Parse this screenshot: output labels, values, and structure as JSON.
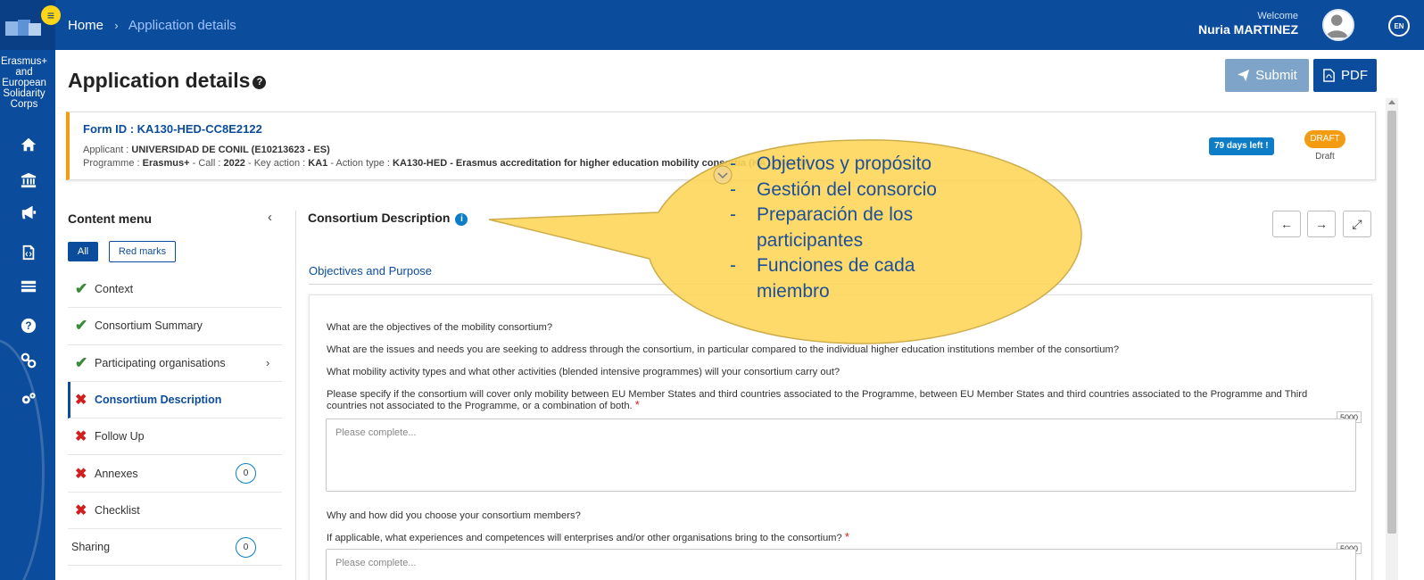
{
  "topbar": {
    "home": "Home",
    "separator": "›",
    "current": "Application details",
    "welcome": "Welcome",
    "user_name": "Nuria MARTINEZ",
    "lang": "EN"
  },
  "sidebar": {
    "program_name": "Erasmus+ and European Solidarity Corps",
    "menu_toggle": "≡",
    "icons": [
      "home-icon",
      "institution-icon",
      "megaphone-icon",
      "document-code-icon",
      "list-icon",
      "help-icon",
      "link-icon",
      "settings-icon"
    ]
  },
  "header": {
    "title": "Application details",
    "help_glyph": "?",
    "submit_label": "Submit",
    "pdf_label": "PDF"
  },
  "form": {
    "id_label": "Form ID : KA130-HED-CC8E2122",
    "applicant_prefix": "Applicant : ",
    "applicant": "UNIVERSIDAD DE CONIL (E10213623 - ES)",
    "programme_prefix": "Programme : ",
    "programme": "Erasmus+",
    "call_prefix": " - Call : ",
    "call": "2022",
    "key_action_prefix": " - Key action : ",
    "key_action": "KA1",
    "action_type_prefix": " - Action type : ",
    "action_type": "KA130-HED - Erasmus accreditation for higher education mobility consortia (KA130-HED)",
    "days_left": "79 days left !",
    "status_badge": "DRAFT",
    "status_label": "Draft"
  },
  "content_menu": {
    "title": "Content menu",
    "collapse": "‹",
    "filter_all": "All",
    "filter_red": "Red marks",
    "items": [
      {
        "label": "Context",
        "status": "ok",
        "status_glyph": "✔",
        "count": "",
        "chevron": ""
      },
      {
        "label": "Consortium Summary",
        "status": "ok",
        "status_glyph": "✔",
        "count": "",
        "chevron": ""
      },
      {
        "label": "Participating organisations",
        "status": "ok",
        "status_glyph": "✔",
        "count": "",
        "chevron": "›"
      },
      {
        "label": "Consortium Description",
        "status": "bad",
        "status_glyph": "✖",
        "count": "",
        "chevron": ""
      },
      {
        "label": "Follow Up",
        "status": "bad",
        "status_glyph": "✖",
        "count": "",
        "chevron": ""
      },
      {
        "label": "Annexes",
        "status": "bad",
        "status_glyph": "✖",
        "count": "0",
        "chevron": ""
      },
      {
        "label": "Checklist",
        "status": "bad",
        "status_glyph": "✖",
        "count": "",
        "chevron": ""
      },
      {
        "label": "Sharing",
        "status": "none",
        "status_glyph": "",
        "count": "0",
        "chevron": ""
      }
    ]
  },
  "main": {
    "section_title": "Consortium Description",
    "info_glyph": "i",
    "nav_prev": "←",
    "nav_next": "→",
    "nav_expand": "⤢",
    "subsection": "Objectives and Purpose",
    "questions": [
      "What are the objectives of the mobility consortium?",
      "What are the issues and needs you are seeking to address through the consortium, in particular compared to the individual higher education institutions member of the consortium?",
      "What mobility activity types and what other activities (blended intensive programmes) will your consortium carry out?",
      "Please specify if the consortium will cover only mobility between EU Member States and third countries associated to the Programme, between EU Member States and third countries associated to the Programme and Third countries not associated to the Programme, or a combination of both.",
      "Why and how did you choose your consortium members?",
      "If applicable, what experiences and competences will enterprises and/or other organisations bring to the consortium?"
    ],
    "required_mark": "*",
    "placeholder": "Please complete...",
    "char_limit": "5000"
  },
  "callout": {
    "items": [
      {
        "dash": "-",
        "text": "Objetivos y propósito"
      },
      {
        "dash": "-",
        "text": "Gestión del consorcio"
      },
      {
        "dash": "-",
        "text": "Preparación de los participantes"
      },
      {
        "dash": "-",
        "text": "Funciones de cada miembro"
      }
    ],
    "fill": "#fdd65a",
    "text_color": "#1e4f98"
  }
}
